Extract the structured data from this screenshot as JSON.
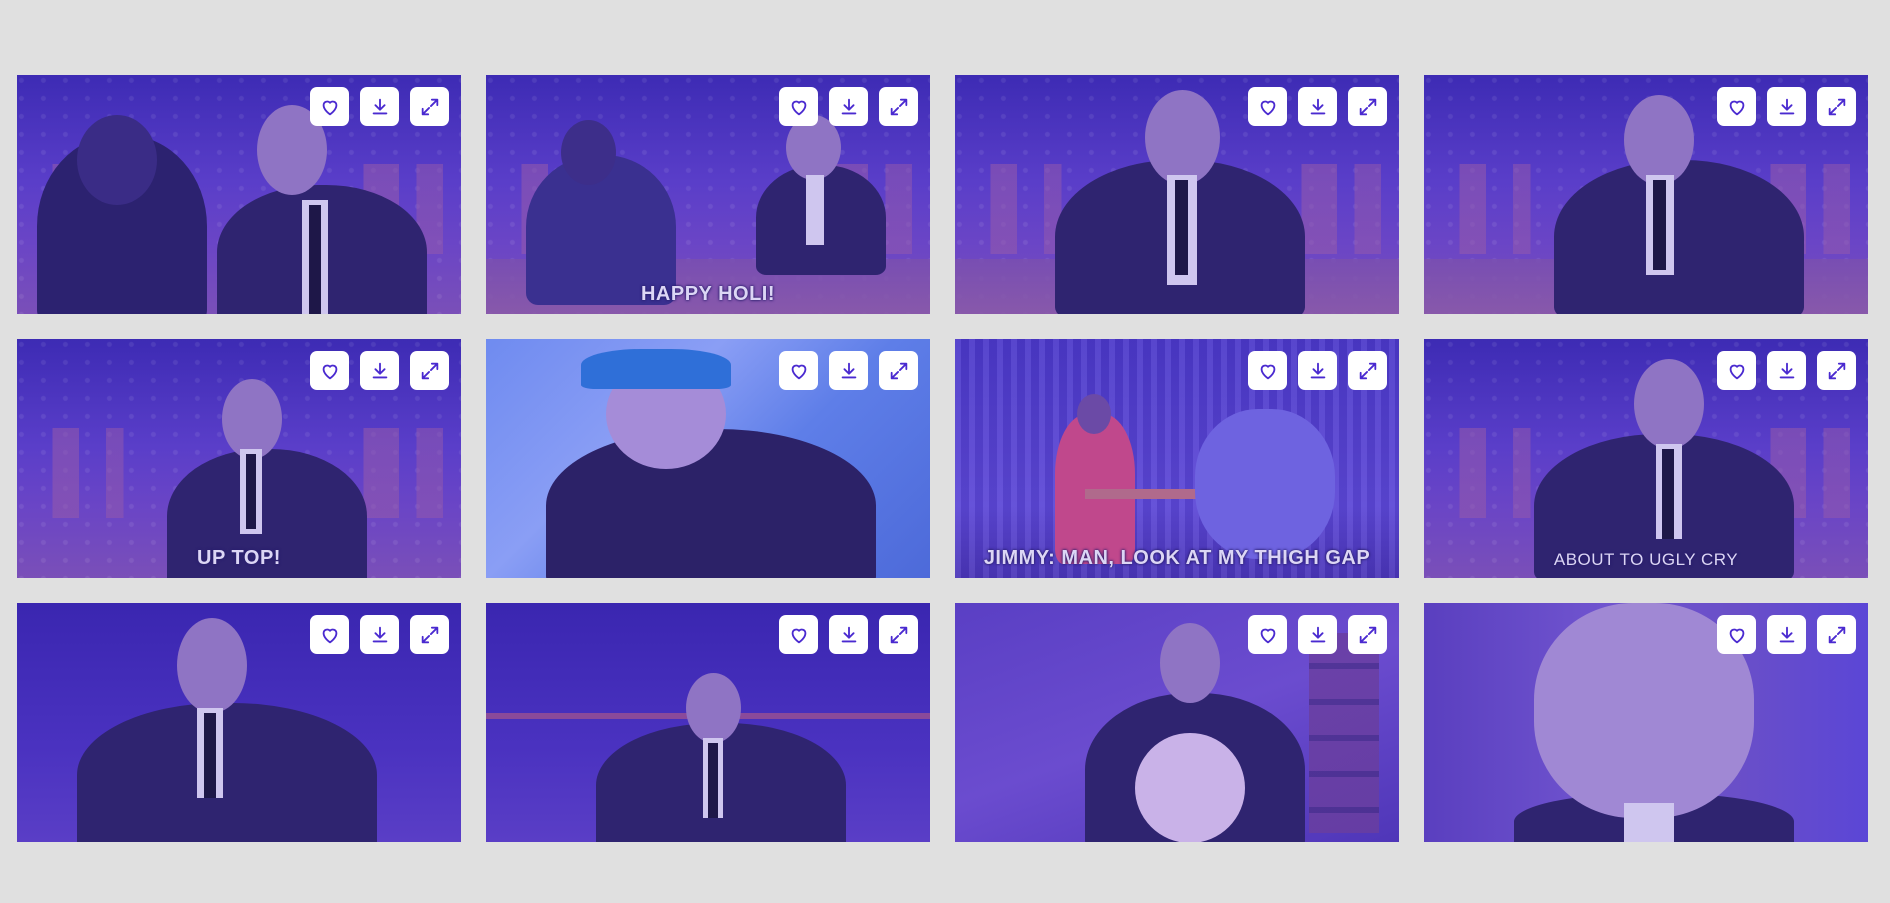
{
  "tiles": [
    {
      "caption": ""
    },
    {
      "caption": "HAPPY HOLI!"
    },
    {
      "caption": ""
    },
    {
      "caption": ""
    },
    {
      "caption": "UP TOP!"
    },
    {
      "caption": ""
    },
    {
      "caption": "JIMMY: MAN, LOOK AT MY THIGH GAP"
    },
    {
      "caption": "ABOUT TO UGLY CRY"
    },
    {
      "caption": ""
    },
    {
      "caption": ""
    },
    {
      "caption": ""
    },
    {
      "caption": ""
    }
  ],
  "actions": [
    "heart-icon",
    "download-icon",
    "expand-icon"
  ],
  "colors": {
    "page_background": "#e0e0e0",
    "tile_tint": "#4a2ad0",
    "button_background": "#ffffff",
    "icon_color": "#4a2ad0"
  }
}
